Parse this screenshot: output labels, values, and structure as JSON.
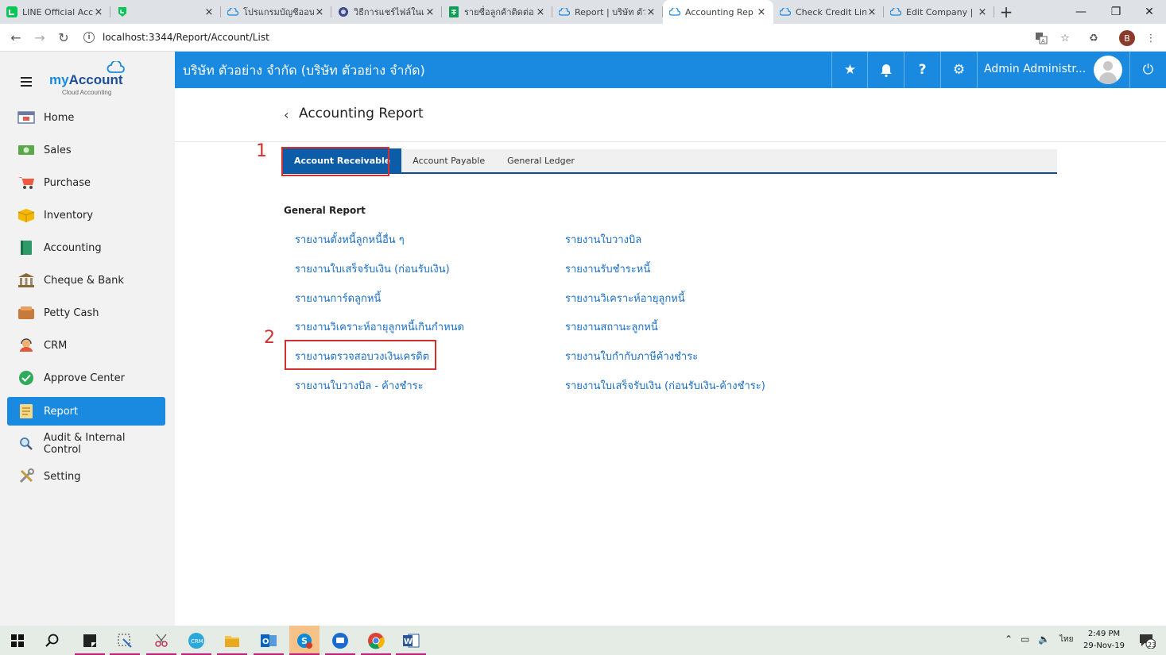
{
  "browser": {
    "tabs": [
      {
        "label": "LINE Official Acc",
        "icon": "line-icon"
      },
      {
        "label": "",
        "icon": "line-icon"
      },
      {
        "label": "โปรแกรมบัญชีออนไ",
        "icon": "cloud-icon"
      },
      {
        "label": "วิธีการแชร์ไฟล์ในเ",
        "icon": "globe-icon"
      },
      {
        "label": "รายชื่อลูกค้าติดต่อ",
        "icon": "sheets-icon"
      },
      {
        "label": "Report | บริษัท ตัว",
        "icon": "cloud-icon"
      },
      {
        "label": "Accounting Rep",
        "icon": "cloud-icon",
        "active": true
      },
      {
        "label": "Check Credit Lin",
        "icon": "cloud-icon"
      },
      {
        "label": "Edit Company | ",
        "icon": "cloud-icon"
      }
    ],
    "new_tab": "+",
    "url": "localhost:3344/Report/Account/List",
    "profile_initial": "B"
  },
  "header": {
    "company": "บริษัท ตัวอย่าง จำกัด (บริษัท ตัวอย่าง จำกัด)",
    "admin_name": "Admin Administr...",
    "accent": "#1a8ae0"
  },
  "logo": {
    "brand_prefix": "my",
    "brand_suffix": "Account",
    "tagline": "Cloud Accounting"
  },
  "sidebar": {
    "items": [
      {
        "label": "Home",
        "icon": "home-icon"
      },
      {
        "label": "Sales",
        "icon": "sales-icon"
      },
      {
        "label": "Purchase",
        "icon": "cart-icon"
      },
      {
        "label": "Inventory",
        "icon": "box-icon"
      },
      {
        "label": "Accounting",
        "icon": "book-icon"
      },
      {
        "label": "Cheque & Bank",
        "icon": "bank-icon"
      },
      {
        "label": "Petty Cash",
        "icon": "wallet-icon"
      },
      {
        "label": "CRM",
        "icon": "crm-icon"
      },
      {
        "label": "Approve Center",
        "icon": "check-icon"
      },
      {
        "label": "Report",
        "icon": "report-icon",
        "active": true
      },
      {
        "label": "Audit & Internal Control",
        "icon": "magnifier-icon"
      },
      {
        "label": "Setting",
        "icon": "tools-icon"
      }
    ]
  },
  "page": {
    "title": "Accounting Report",
    "tabs": [
      "Account Receivable",
      "Account Payable",
      "General Ledger"
    ],
    "active_tab": "Account Receivable",
    "section_heading": "General Report",
    "reports_left": [
      "รายงานตั้งหนี้ลูกหนี้อื่น ๆ",
      "รายงานใบเสร็จรับเงิน (ก่อนรับเงิน)",
      "รายงานการ์ดลูกหนี้",
      "รายงานวิเคราะห์อายุลูกหนี้เกินกำหนด",
      "รายงานตรวจสอบวงเงินเครดิต",
      "รายงานใบวางบิล - ค้างชำระ"
    ],
    "reports_right": [
      "รายงานใบวางบิล",
      "รายงานรับชำระหนี้",
      "รายงานวิเคราะห์อายุลูกหนี้",
      "รายงานสถานะลูกหนี้",
      "รายงานใบกำกับภาษีค้างชำระ",
      "รายงานใบเสร็จรับเงิน (ก่อนรับเงิน-ค้างชำระ)"
    ],
    "annotation_1": "1",
    "annotation_2": "2",
    "annotation_color": "#d32f2f"
  },
  "taskbar": {
    "time": "2:49 PM",
    "date": "29-Nov-19",
    "lang": "ไทย",
    "notification_count": "23"
  }
}
